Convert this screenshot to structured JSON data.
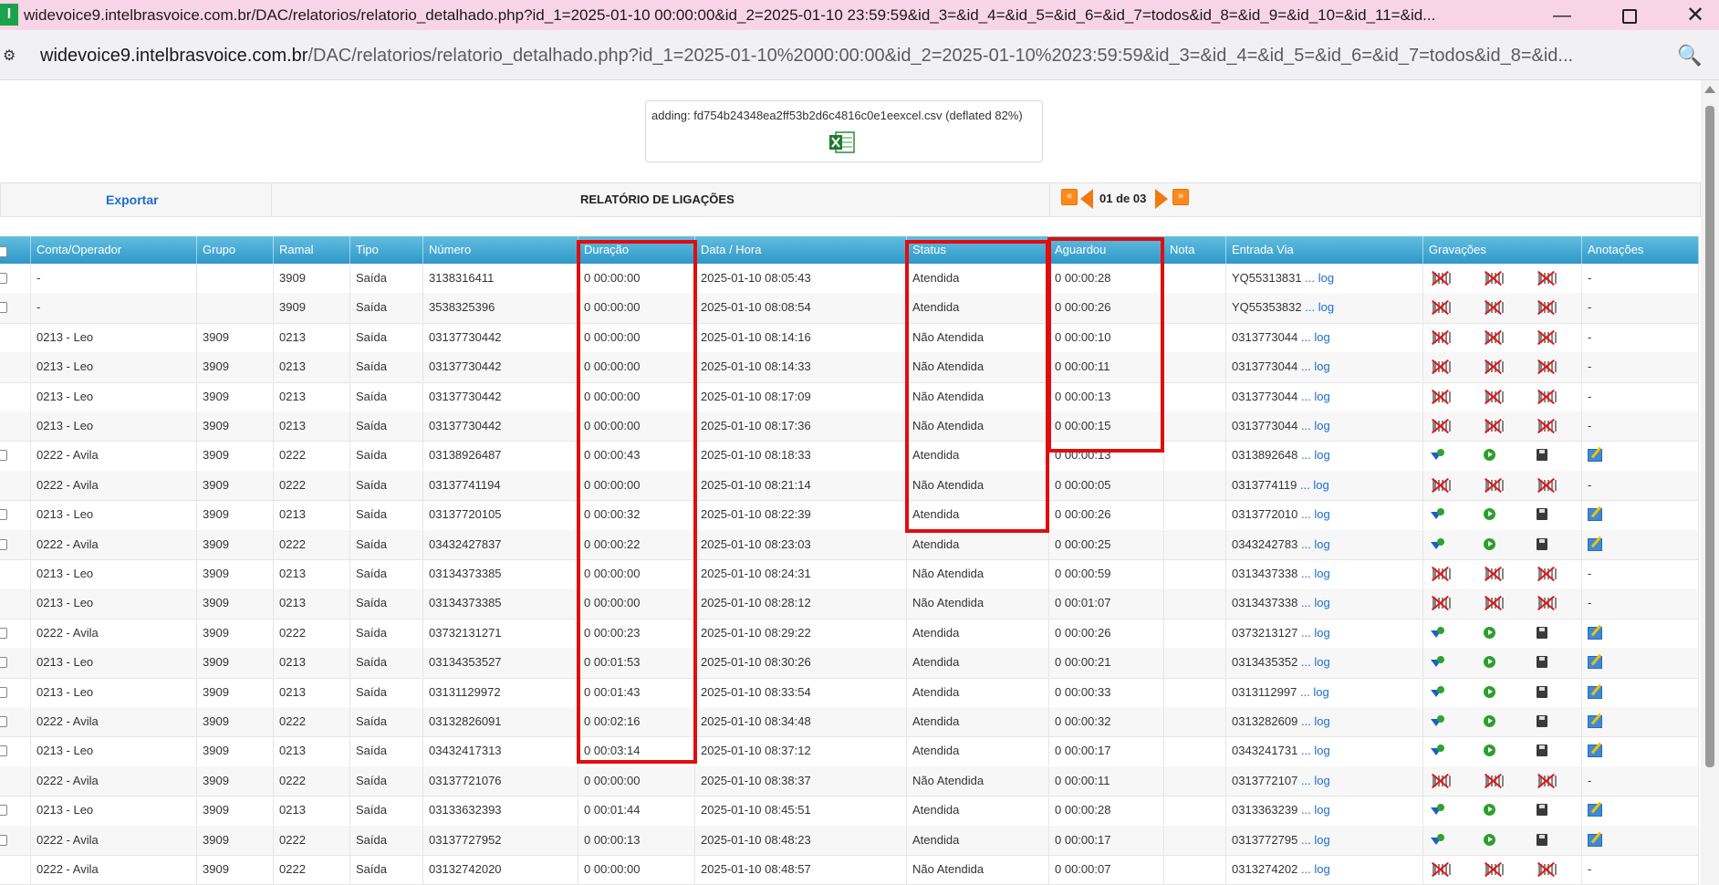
{
  "window": {
    "app_icon": "I",
    "title": "widevoice9.intelbrasvoice.com.br/DAC/relatorios/relatorio_detalhado.php?id_1=2025-01-10 00:00:00&id_2=2025-01-10 23:59:59&id_3=&id_4=&id_5=&id_6=&id_7=todos&id_8=&id_9=&id_10=&id_11=&id...",
    "minimize": "—",
    "close": "✕"
  },
  "address": {
    "host": "widevoice9.intelbrasvoice.com.br",
    "path": "/DAC/relatorios/relatorio_detalhado.php?id_1=2025-01-10%2000:00:00&id_2=2025-01-10%2023:59:59&id_3=&id_4=&id_5=&id_6=&id_7=todos&id_8=&id...",
    "site_icon": "⚙",
    "zoom_icon": "🔍"
  },
  "zip": {
    "message": "adding: fd754b24348ea2ff53b2d6c4816c0e1eexcel.csv (deflated 82%)"
  },
  "toolbar": {
    "export": "Exportar",
    "title": "RELATÓRIO DE LIGAÇÕES",
    "first": "«",
    "last": "»",
    "page_label": "01 de 03"
  },
  "table": {
    "headers": {
      "conta": "Conta/Operador",
      "grupo": "Grupo",
      "ramal": "Ramal",
      "tipo": "Tipo",
      "numero": "Número",
      "duracao": "Duração",
      "datahora": "Data / Hora",
      "status": "Status",
      "aguardou": "Aguardou",
      "nota": "Nota",
      "entrada": "Entrada Via",
      "gravacoes": "Gravações",
      "anotacoes": "Anotações"
    },
    "log_label": "... log",
    "rows": [
      {
        "conta": "-",
        "grupo": "",
        "ramal": "3909",
        "tipo": "Saída",
        "numero": "3138316411",
        "duracao": "0 00:00:00",
        "datahora": "2025-01-10 08:05:43",
        "status": "Atendida",
        "aguardou": "0 00:00:28",
        "entrada": "YQ55313831",
        "anot": "-",
        "rec": false
      },
      {
        "conta": "-",
        "grupo": "",
        "ramal": "3909",
        "tipo": "Saída",
        "numero": "3538325396",
        "duracao": "0 00:00:00",
        "datahora": "2025-01-10 08:08:54",
        "status": "Atendida",
        "aguardou": "0 00:00:26",
        "entrada": "YQ55353832",
        "anot": "-",
        "rec": false
      },
      {
        "conta": "0213 - Leo",
        "grupo": "3909",
        "ramal": "0213",
        "tipo": "Saída",
        "numero": "03137730442",
        "duracao": "0 00:00:00",
        "datahora": "2025-01-10 08:14:16",
        "status": "Não Atendida",
        "aguardou": "0 00:00:10",
        "entrada": "0313773044",
        "anot": "-",
        "rec": false
      },
      {
        "conta": "0213 - Leo",
        "grupo": "3909",
        "ramal": "0213",
        "tipo": "Saída",
        "numero": "03137730442",
        "duracao": "0 00:00:00",
        "datahora": "2025-01-10 08:14:33",
        "status": "Não Atendida",
        "aguardou": "0 00:00:11",
        "entrada": "0313773044",
        "anot": "-",
        "rec": false
      },
      {
        "conta": "0213 - Leo",
        "grupo": "3909",
        "ramal": "0213",
        "tipo": "Saída",
        "numero": "03137730442",
        "duracao": "0 00:00:00",
        "datahora": "2025-01-10 08:17:09",
        "status": "Não Atendida",
        "aguardou": "0 00:00:13",
        "entrada": "0313773044",
        "anot": "-",
        "rec": false
      },
      {
        "conta": "0213 - Leo",
        "grupo": "3909",
        "ramal": "0213",
        "tipo": "Saída",
        "numero": "03137730442",
        "duracao": "0 00:00:00",
        "datahora": "2025-01-10 08:17:36",
        "status": "Não Atendida",
        "aguardou": "0 00:00:15",
        "entrada": "0313773044",
        "anot": "-",
        "rec": false
      },
      {
        "conta": "0222 - Avila",
        "grupo": "3909",
        "ramal": "0222",
        "tipo": "Saída",
        "numero": "03138926487",
        "duracao": "0 00:00:43",
        "datahora": "2025-01-10 08:18:33",
        "status": "Atendida",
        "aguardou": "0 00:00:13",
        "entrada": "0313892648",
        "anot": "",
        "rec": true
      },
      {
        "conta": "0222 - Avila",
        "grupo": "3909",
        "ramal": "0222",
        "tipo": "Saída",
        "numero": "03137741194",
        "duracao": "0 00:00:00",
        "datahora": "2025-01-10 08:21:14",
        "status": "Não Atendida",
        "aguardou": "0 00:00:05",
        "entrada": "0313774119",
        "anot": "-",
        "rec": false
      },
      {
        "conta": "0213 - Leo",
        "grupo": "3909",
        "ramal": "0213",
        "tipo": "Saída",
        "numero": "03137720105",
        "duracao": "0 00:00:32",
        "datahora": "2025-01-10 08:22:39",
        "status": "Atendida",
        "aguardou": "0 00:00:26",
        "entrada": "0313772010",
        "anot": "",
        "rec": true
      },
      {
        "conta": "0222 - Avila",
        "grupo": "3909",
        "ramal": "0222",
        "tipo": "Saída",
        "numero": "03432427837",
        "duracao": "0 00:00:22",
        "datahora": "2025-01-10 08:23:03",
        "status": "Atendida",
        "aguardou": "0 00:00:25",
        "entrada": "0343242783",
        "anot": "",
        "rec": true
      },
      {
        "conta": "0213 - Leo",
        "grupo": "3909",
        "ramal": "0213",
        "tipo": "Saída",
        "numero": "03134373385",
        "duracao": "0 00:00:00",
        "datahora": "2025-01-10 08:24:31",
        "status": "Não Atendida",
        "aguardou": "0 00:00:59",
        "entrada": "0313437338",
        "anot": "-",
        "rec": false
      },
      {
        "conta": "0213 - Leo",
        "grupo": "3909",
        "ramal": "0213",
        "tipo": "Saída",
        "numero": "03134373385",
        "duracao": "0 00:00:00",
        "datahora": "2025-01-10 08:28:12",
        "status": "Não Atendida",
        "aguardou": "0 00:01:07",
        "entrada": "0313437338",
        "anot": "-",
        "rec": false
      },
      {
        "conta": "0222 - Avila",
        "grupo": "3909",
        "ramal": "0222",
        "tipo": "Saída",
        "numero": "03732131271",
        "duracao": "0 00:00:23",
        "datahora": "2025-01-10 08:29:22",
        "status": "Atendida",
        "aguardou": "0 00:00:26",
        "entrada": "0373213127",
        "anot": "",
        "rec": true
      },
      {
        "conta": "0213 - Leo",
        "grupo": "3909",
        "ramal": "0213",
        "tipo": "Saída",
        "numero": "03134353527",
        "duracao": "0 00:01:53",
        "datahora": "2025-01-10 08:30:26",
        "status": "Atendida",
        "aguardou": "0 00:00:21",
        "entrada": "0313435352",
        "anot": "",
        "rec": true
      },
      {
        "conta": "0213 - Leo",
        "grupo": "3909",
        "ramal": "0213",
        "tipo": "Saída",
        "numero": "03131129972",
        "duracao": "0 00:01:43",
        "datahora": "2025-01-10 08:33:54",
        "status": "Atendida",
        "aguardou": "0 00:00:33",
        "entrada": "0313112997",
        "anot": "",
        "rec": true
      },
      {
        "conta": "0222 - Avila",
        "grupo": "3909",
        "ramal": "0222",
        "tipo": "Saída",
        "numero": "03132826091",
        "duracao": "0 00:02:16",
        "datahora": "2025-01-10 08:34:48",
        "status": "Atendida",
        "aguardou": "0 00:00:32",
        "entrada": "0313282609",
        "anot": "",
        "rec": true
      },
      {
        "conta": "0213 - Leo",
        "grupo": "3909",
        "ramal": "0213",
        "tipo": "Saída",
        "numero": "03432417313",
        "duracao": "0 00:03:14",
        "datahora": "2025-01-10 08:37:12",
        "status": "Atendida",
        "aguardou": "0 00:00:17",
        "entrada": "0343241731",
        "anot": "",
        "rec": true
      },
      {
        "conta": "0222 - Avila",
        "grupo": "3909",
        "ramal": "0222",
        "tipo": "Saída",
        "numero": "03137721076",
        "duracao": "0 00:00:00",
        "datahora": "2025-01-10 08:38:37",
        "status": "Não Atendida",
        "aguardou": "0 00:00:11",
        "entrada": "0313772107",
        "anot": "-",
        "rec": false
      },
      {
        "conta": "0213 - Leo",
        "grupo": "3909",
        "ramal": "0213",
        "tipo": "Saída",
        "numero": "03133632393",
        "duracao": "0 00:01:44",
        "datahora": "2025-01-10 08:45:51",
        "status": "Atendida",
        "aguardou": "0 00:00:28",
        "entrada": "0313363239",
        "anot": "",
        "rec": true
      },
      {
        "conta": "0222 - Avila",
        "grupo": "3909",
        "ramal": "0222",
        "tipo": "Saída",
        "numero": "03137727952",
        "duracao": "0 00:00:13",
        "datahora": "2025-01-10 08:48:23",
        "status": "Atendida",
        "aguardou": "0 00:00:17",
        "entrada": "0313772795",
        "anot": "",
        "rec": true
      },
      {
        "conta": "0222 - Avila",
        "grupo": "3909",
        "ramal": "0222",
        "tipo": "Saída",
        "numero": "03132742020",
        "duracao": "0 00:00:00",
        "datahora": "2025-01-10 08:48:57",
        "status": "Não Atendida",
        "aguardou": "0 00:00:07",
        "entrada": "0313274202",
        "anot": "-",
        "rec": false
      }
    ]
  },
  "colors": {
    "header_top": "#63bde0",
    "header_bottom": "#2e98c7",
    "link": "#1a6ed0",
    "highlight": "#e00d0d",
    "pager": "#f07a10"
  }
}
